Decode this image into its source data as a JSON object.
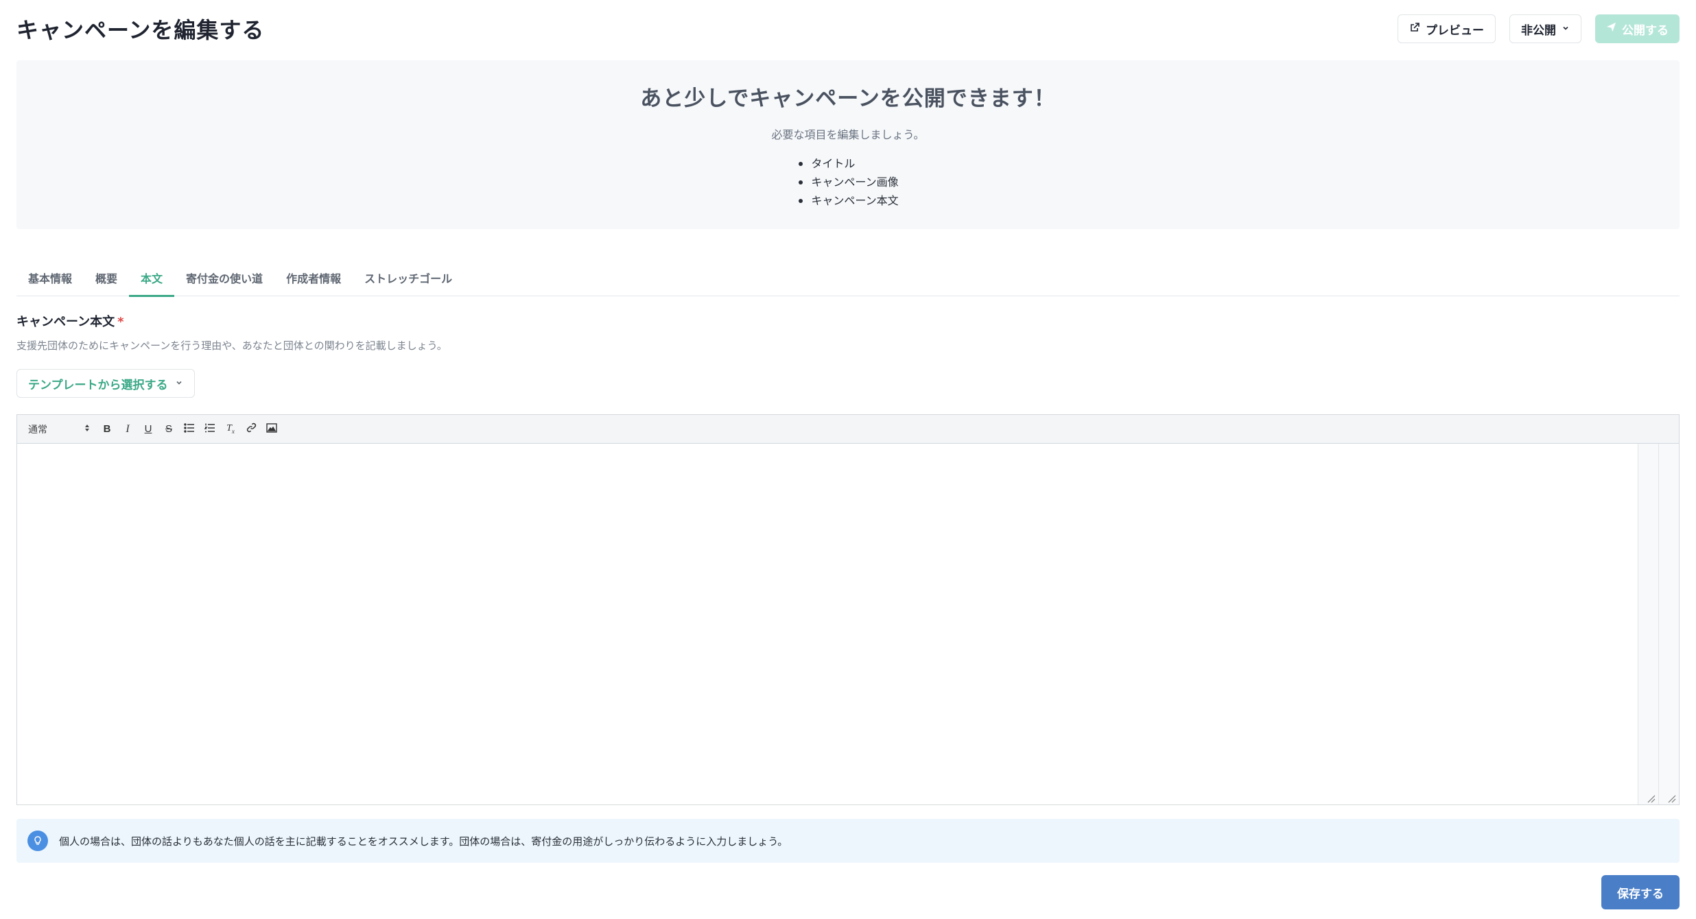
{
  "header": {
    "title": "キャンペーンを編集する",
    "preview_label": "プレビュー",
    "visibility_label": "非公開",
    "publish_label": "公開する"
  },
  "notice": {
    "title": "あと少しでキャンペーンを公開できます！",
    "subtitle": "必要な項目を編集しましょう。",
    "items": [
      "タイトル",
      "キャンペーン画像",
      "キャンペーン本文"
    ]
  },
  "tabs": [
    {
      "label": "基本情報",
      "active": false
    },
    {
      "label": "概要",
      "active": false
    },
    {
      "label": "本文",
      "active": true
    },
    {
      "label": "寄付金の使い道",
      "active": false
    },
    {
      "label": "作成者情報",
      "active": false
    },
    {
      "label": "ストレッチゴール",
      "active": false
    }
  ],
  "field": {
    "label": "キャンペーン本文",
    "required_mark": "*",
    "help": "支援先団体のためにキャンペーンを行う理由や、あなたと団体との関わりを記載しましょう。",
    "template_label": "テンプレートから選択する"
  },
  "editor": {
    "format_value": "通常",
    "body": ""
  },
  "tip": {
    "text": "個人の場合は、団体の話よりもあなた個人の話を主に記載することをオススメします。団体の場合は、寄付金の用途がしっかり伝わるように入力しましょう。"
  },
  "footer": {
    "save_label": "保存する"
  },
  "colors": {
    "accent": "#3aa886",
    "publish_disabled": "#b4e6d7",
    "save": "#4a7fc8",
    "tip_bg": "#edf6fd",
    "required": "#e04848"
  }
}
